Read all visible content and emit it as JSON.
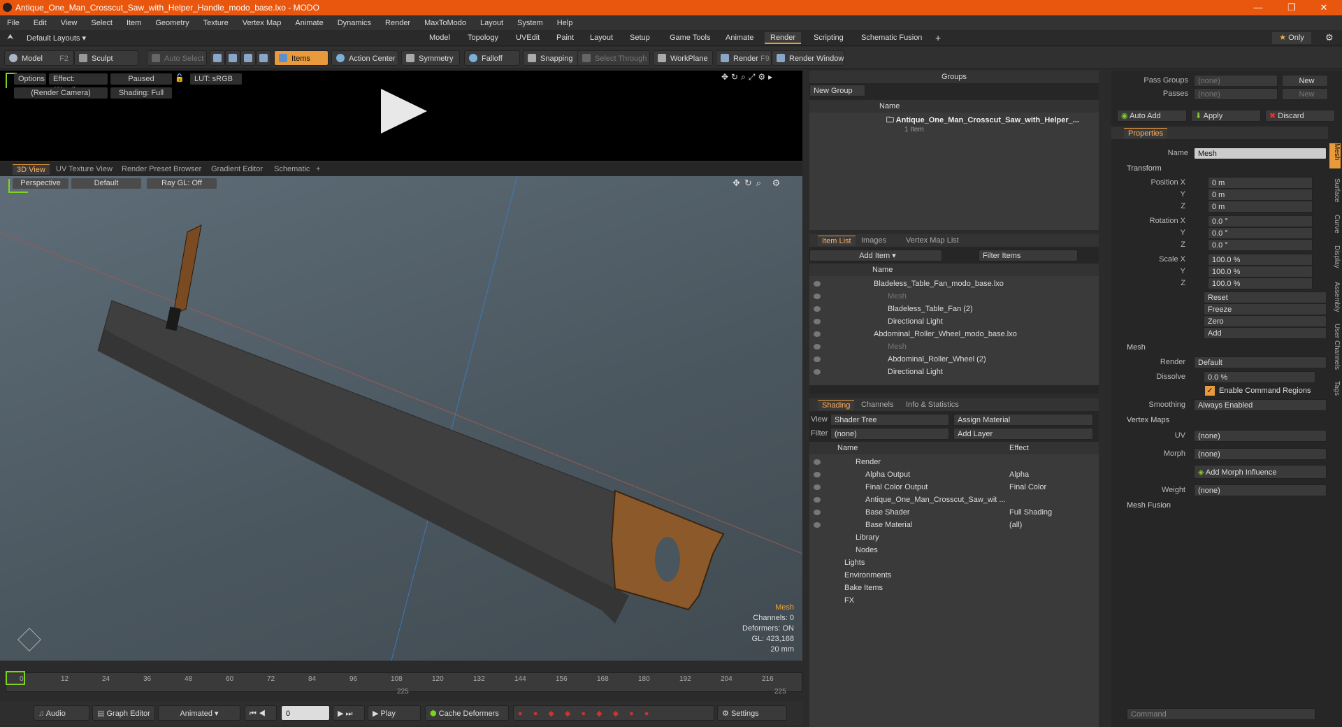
{
  "window": {
    "title": "Antique_One_Man_Crosscut_Saw_with_Helper_Handle_modo_base.lxo - MODO",
    "min": "—",
    "max": "❐",
    "close": "✕"
  },
  "menu": [
    "File",
    "Edit",
    "View",
    "Select",
    "Item",
    "Geometry",
    "Texture",
    "Vertex Map",
    "Animate",
    "Dynamics",
    "Render",
    "MaxToModo",
    "Layout",
    "System",
    "Help"
  ],
  "layout": {
    "preset": "Default Layouts",
    "tabs": [
      "Model",
      "Topology",
      "UVEdit",
      "Paint",
      "Layout",
      "Setup",
      "Game Tools",
      "Animate",
      "Render",
      "Scripting",
      "Schematic Fusion"
    ],
    "active": "Render",
    "only": "Only",
    "plus": "+"
  },
  "toolbar": {
    "model": "Model",
    "model_key": "F2",
    "sculpt": "Sculpt",
    "auto_select": "Auto Select",
    "items": "Items",
    "action_center": "Action Center",
    "symmetry": "Symmetry",
    "falloff": "Falloff",
    "snapping": "Snapping",
    "select_through": "Select Through",
    "workplane": "WorkPlane",
    "render": "Render",
    "render_key": "F9",
    "render_window": "Render Window"
  },
  "preview": {
    "options": "Options",
    "effect": "Effect: (Shadi...",
    "paused": "Paused",
    "lut": "LUT: sRGB",
    "camera": "(Render Camera)",
    "shading": "Shading: Full"
  },
  "viewport_tabs": [
    "3D View",
    "UV Texture View",
    "Render Preset Browser",
    "Gradient Editor",
    "Schematic"
  ],
  "viewport": {
    "perspective": "Perspective",
    "default": "Default",
    "raygl": "Ray GL: Off",
    "stats": {
      "label": "Mesh",
      "channels": "Channels: 0",
      "deformers": "Deformers: ON",
      "gl": "GL: 423,168",
      "size": "20 mm"
    }
  },
  "timeline": {
    "ticks": [
      "0",
      "12",
      "24",
      "36",
      "48",
      "60",
      "72",
      "84",
      "96",
      "108",
      "120",
      "132",
      "144",
      "156",
      "168",
      "180",
      "192",
      "204",
      "216"
    ],
    "mark1": "225",
    "mark2": "225"
  },
  "bottom": {
    "audio": "Audio",
    "graph": "Graph Editor",
    "animated": "Animated",
    "frame": "0",
    "play": "Play",
    "cache": "Cache Deformers",
    "settings": "Settings"
  },
  "groups": {
    "title": "Groups",
    "new_group": "New Group",
    "col_name": "Name",
    "item": "Antique_One_Man_Crosscut_Saw_with_Helper_...",
    "item_count": "1 Item"
  },
  "itemlist": {
    "tabs": [
      "Item List",
      "Images",
      "Vertex Map List"
    ],
    "add_item": "Add Item",
    "filter": "Filter Items",
    "col_name": "Name",
    "rows": [
      {
        "label": "Bladeless_Table_Fan_modo_base.lxo",
        "indent": 0,
        "dim": false
      },
      {
        "label": "Mesh",
        "indent": 2,
        "dim": true
      },
      {
        "label": "Bladeless_Table_Fan (2)",
        "indent": 2,
        "dim": false
      },
      {
        "label": "Directional Light",
        "indent": 2,
        "dim": false
      },
      {
        "label": "Abdominal_Roller_Wheel_modo_base.lxo",
        "indent": 0,
        "dim": false
      },
      {
        "label": "Mesh",
        "indent": 2,
        "dim": true
      },
      {
        "label": "Abdominal_Roller_Wheel (2)",
        "indent": 2,
        "dim": false
      },
      {
        "label": "Directional Light",
        "indent": 2,
        "dim": false
      }
    ]
  },
  "shading": {
    "tabs": [
      "Shading",
      "Channels",
      "Info & Statistics"
    ],
    "view_lbl": "View",
    "view": "Shader Tree",
    "assign": "Assign Material",
    "filter_lbl": "Filter",
    "filter": "(none)",
    "add_layer": "Add Layer",
    "col_name": "Name",
    "col_effect": "Effect",
    "rows": [
      {
        "label": "Render",
        "effect": "",
        "indent": 0
      },
      {
        "label": "Alpha Output",
        "effect": "Alpha",
        "indent": 1
      },
      {
        "label": "Final Color Output",
        "effect": "Final Color",
        "indent": 1
      },
      {
        "label": "Antique_One_Man_Crosscut_Saw_wit ...",
        "effect": "",
        "indent": 1
      },
      {
        "label": "Base Shader",
        "effect": "Full Shading",
        "indent": 1
      },
      {
        "label": "Base Material",
        "effect": "(all)",
        "indent": 1
      },
      {
        "label": "Library",
        "effect": "",
        "indent": 0
      },
      {
        "label": "Nodes",
        "effect": "",
        "indent": 0
      },
      {
        "label": "Lights",
        "effect": "",
        "indent": -1
      },
      {
        "label": "Environments",
        "effect": "",
        "indent": -1
      },
      {
        "label": "Bake Items",
        "effect": "",
        "indent": -1
      },
      {
        "label": "FX",
        "effect": "",
        "indent": -1
      }
    ]
  },
  "props": {
    "pass_groups": "Pass Groups",
    "passes": "Passes",
    "none": "(none)",
    "new": "New",
    "auto_add": "Auto Add",
    "apply": "Apply",
    "discard": "Discard",
    "tab": "Properties",
    "name_lbl": "Name",
    "name": "Mesh",
    "transform": "Transform",
    "pos_lbl": "Position X",
    "rot_lbl": "Rotation X",
    "scale_lbl": "Scale X",
    "y": "Y",
    "z": "Z",
    "pos": "0 m",
    "rot": "0.0 °",
    "scale": "100.0 %",
    "reset": "Reset",
    "freeze": "Freeze",
    "zero": "Zero",
    "add": "Add",
    "mesh_sect": "Mesh",
    "render_lbl": "Render",
    "render_val": "Default",
    "dissolve_lbl": "Dissolve",
    "dissolve": "0.0 %",
    "ecr": "Enable Command Regions",
    "smooth_lbl": "Smoothing",
    "smooth": "Always Enabled",
    "vmaps": "Vertex Maps",
    "uv_lbl": "UV",
    "morph_lbl": "Morph",
    "add_morph": "Add Morph Influence",
    "weight_lbl": "Weight",
    "mesh_fusion": "Mesh Fusion",
    "command": "Command",
    "side_tabs": [
      "Mesh",
      "Surface",
      "Curve",
      "Display",
      "Assembly",
      "User Channels",
      "Tags"
    ]
  }
}
